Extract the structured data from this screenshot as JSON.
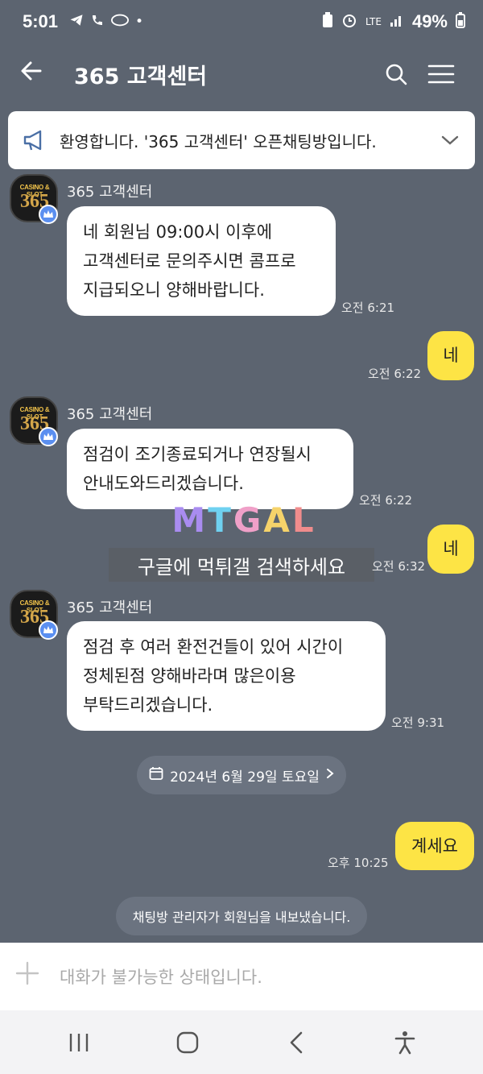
{
  "status_bar": {
    "time": "5:01",
    "battery": "49%",
    "network": "LTE"
  },
  "header": {
    "title": "365 고객센터",
    "back_icon": "arrow-left-icon",
    "search_icon": "search-icon",
    "menu_icon": "hamburger-menu-icon"
  },
  "notice": {
    "text": "환영합니다. '365 고객센터' 오픈채팅방입니다.",
    "icon": "megaphone-icon"
  },
  "messages": [
    {
      "direction": "in",
      "sender": "365 고객센터",
      "lines": [
        "네 회원님 09:00시 이후에",
        "고객센터로 문의주시면 콤프로",
        "지급되오니 양해바랍니다."
      ],
      "time": "오전 6:21"
    },
    {
      "direction": "out",
      "lines": [
        "네"
      ],
      "time": "오전 6:22"
    },
    {
      "direction": "in",
      "sender": "365 고객센터",
      "lines": [
        "점검이 조기종료되거나 연장될시",
        "안내도와드리겠습니다."
      ],
      "time": "오전 6:22"
    },
    {
      "direction": "out",
      "lines": [
        "네"
      ],
      "time": "오전 6:32"
    },
    {
      "direction": "in",
      "sender": "365 고객센터",
      "lines": [
        "점검 후 여러 환전건들이 있어 시간이",
        "정체된점 양해바라며 많은이용",
        "부탁드리겠습니다."
      ],
      "time": "오전 9:31"
    },
    {
      "direction": "out",
      "lines": [
        "계세요"
      ],
      "time": "오후 10:25"
    }
  ],
  "avatar": {
    "top_text": "CASINO & SLOT",
    "number": "365"
  },
  "date_divider": "2024년 6월 29일 토요일",
  "system_message": "채팅방 관리자가 회원님을 내보냈습니다.",
  "watermark": {
    "logo": "MTGAL",
    "text": "구글에 먹튀갤 검색하세요"
  },
  "input": {
    "placeholder": "대화가 불가능한 상태입니다."
  },
  "colors": {
    "background": "#5c6470",
    "bubble_in": "#ffffff",
    "bubble_out": "#fde445"
  }
}
